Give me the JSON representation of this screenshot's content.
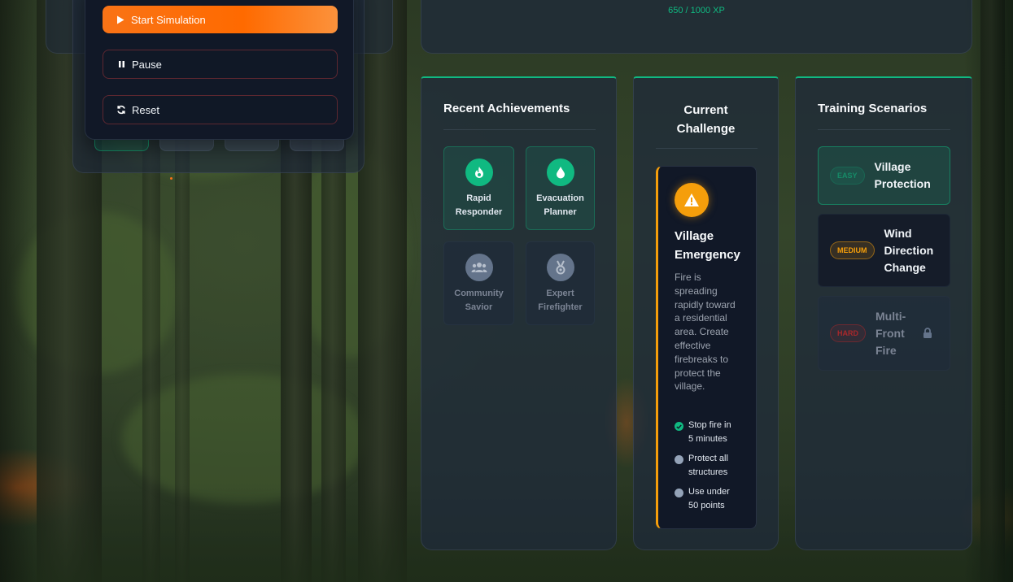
{
  "controls": {
    "start_label": "Start Simulation",
    "pause_label": "Pause",
    "reset_label": "Reset"
  },
  "progress": {
    "xp_text": "650 / 1000 XP",
    "xp_current": 650,
    "xp_max": 1000
  },
  "achievements": {
    "title": "Recent Achievements",
    "items": [
      {
        "name_line1": "Rapid",
        "name_line2": "Responder",
        "icon": "fire-icon",
        "earned": true
      },
      {
        "name_line1": "Evacuation",
        "name_line2": "Planner",
        "icon": "water-drop-icon",
        "earned": true
      },
      {
        "name_line1": "Community",
        "name_line2": "Savior",
        "icon": "users-icon",
        "earned": false
      },
      {
        "name_line1": "Expert",
        "name_line2": "Firefighter",
        "icon": "medal-icon",
        "earned": false
      }
    ]
  },
  "challenge": {
    "title_line1": "Current",
    "title_line2": "Challenge",
    "card_title_line1": "Village",
    "card_title_line2": "Emergency",
    "description": "Fire is spreading rapidly toward a residential area. Create effective firebreaks to protect the village.",
    "objectives": [
      {
        "line1": "Stop fire in",
        "line2": "5 minutes",
        "done": true
      },
      {
        "line1": "Protect all",
        "line2": "structures",
        "done": false
      },
      {
        "line1": "Use under",
        "line2": "50 points",
        "done": false
      }
    ],
    "accent_color": "#f59e0b"
  },
  "scenarios": {
    "title": "Training Scenarios",
    "items": [
      {
        "difficulty": "EASY",
        "name": "Village Protection",
        "locked": false,
        "active": true
      },
      {
        "difficulty": "MEDIUM",
        "name": "Wind Direction Change",
        "locked": false,
        "active": false
      },
      {
        "difficulty": "HARD",
        "name": "Multi-Front Fire",
        "locked": true,
        "active": false
      }
    ]
  },
  "colors": {
    "accent": "#10b981",
    "primary_button": "#f97316",
    "warning": "#f59e0b",
    "danger": "#dc2626"
  }
}
